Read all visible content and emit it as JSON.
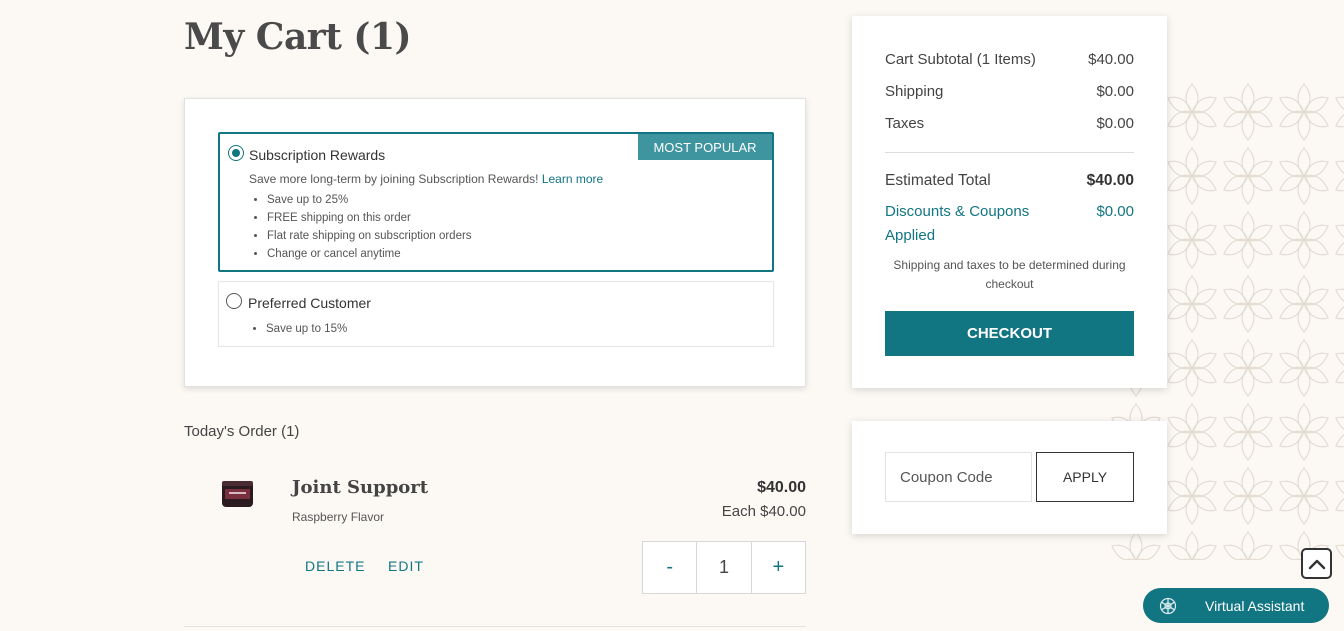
{
  "page": {
    "title": "My Cart (1)"
  },
  "plans": {
    "subscription": {
      "name": "Subscription Rewards",
      "badge": "MOST POPULAR",
      "description": "Save more long-term by joining Subscription Rewards!",
      "learn_more": "Learn more",
      "benefits": [
        "Save up to 25%",
        "FREE shipping on this order",
        "Flat rate shipping on subscription orders",
        "Change or cancel anytime"
      ],
      "selected": true
    },
    "preferred": {
      "name": "Preferred Customer",
      "benefits": [
        "Save up to 15%"
      ],
      "selected": false
    }
  },
  "order": {
    "heading": "Today's Order (1)",
    "items": [
      {
        "name": "Joint Support",
        "flavor": "Raspberry Flavor",
        "price": "$40.00",
        "each": "Each $40.00",
        "quantity": "1",
        "delete_label": "DELETE",
        "edit_label": "EDIT",
        "minus": "-",
        "plus": "+"
      }
    ]
  },
  "summary": {
    "subtotal_label": "Cart Subtotal (1 Items)",
    "subtotal_value": "$40.00",
    "shipping_label": "Shipping",
    "shipping_value": "$0.00",
    "taxes_label": "Taxes",
    "taxes_value": "$0.00",
    "total_label": "Estimated Total",
    "total_value": "$40.00",
    "discounts_label": "Discounts & Coupons Applied",
    "discounts_value": "$0.00",
    "note": "Shipping and taxes to be determined during checkout",
    "checkout_label": "CHECKOUT"
  },
  "coupon": {
    "placeholder": "Coupon Code",
    "apply_label": "APPLY"
  },
  "assistant": {
    "label": "Virtual Assistant"
  },
  "colors": {
    "accent": "#127582",
    "badge": "#3e949f",
    "background": "#fcf9f5"
  }
}
